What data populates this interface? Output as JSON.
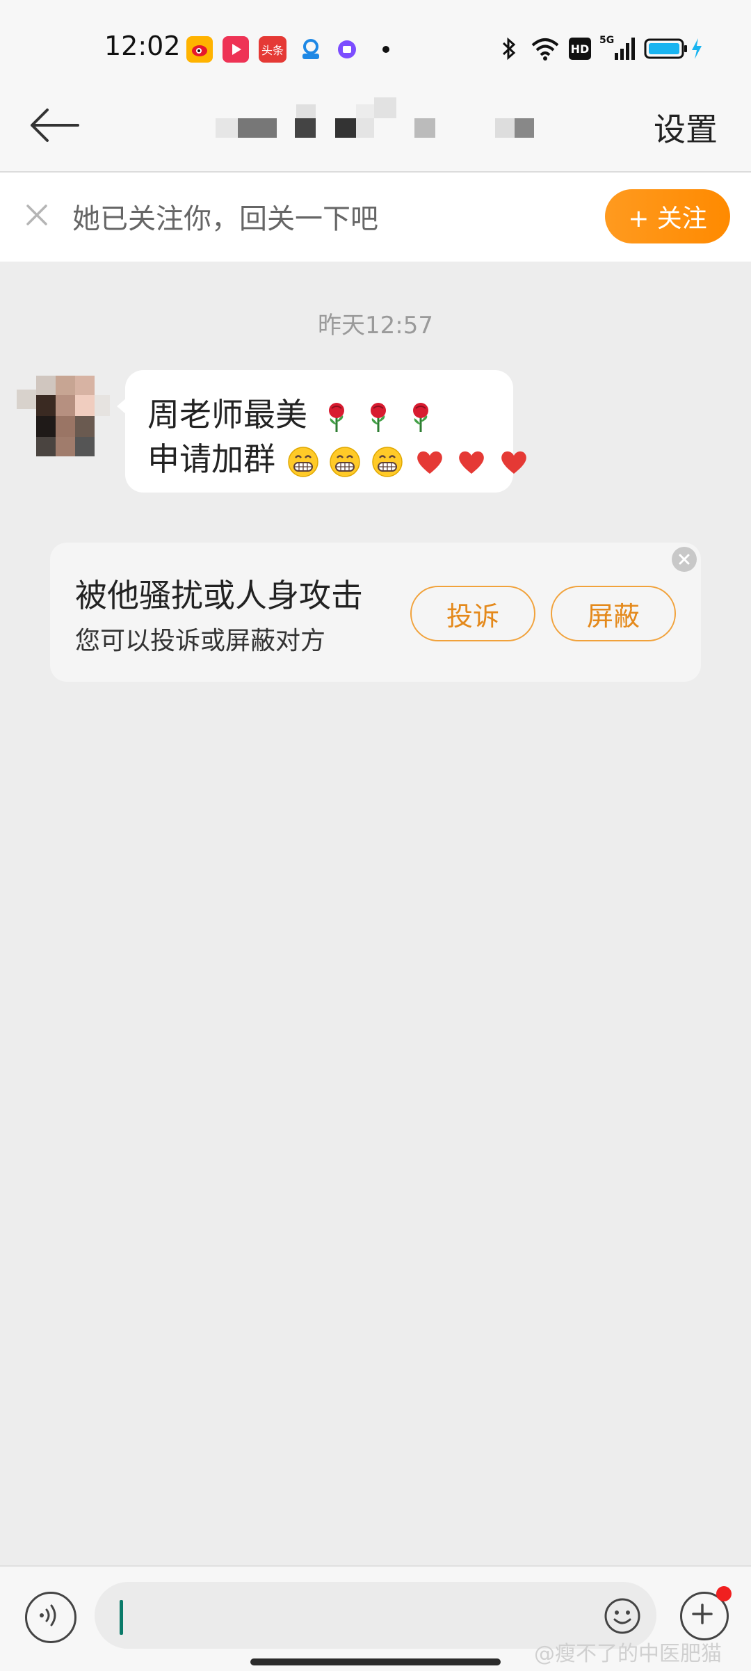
{
  "status_bar": {
    "time": "12:02",
    "left_icons": [
      "weibo-icon",
      "video-play-icon",
      "toutiao-icon",
      "app-icon",
      "purple-app-icon",
      "dot"
    ],
    "left_badge_text": "头条",
    "right_icons": [
      "bluetooth-icon",
      "wifi-icon",
      "hd-icon",
      "signal-5g-icon",
      "battery-icon",
      "charging-icon"
    ],
    "hd_text": "HD",
    "network_text": "5G"
  },
  "nav": {
    "back_icon": "back-arrow-icon",
    "settings_label": "设置"
  },
  "follow_banner": {
    "text": "她已关注你，回关一下吧",
    "button_label": "+ 关注"
  },
  "chat": {
    "time_label": "昨天12:57",
    "message": {
      "line1_text": "周老师最美",
      "line2_text": "申请加群"
    }
  },
  "safety_card": {
    "title": "被他骚扰或人身攻击",
    "subtitle": "您可以投诉或屏蔽对方",
    "report_label": "投诉",
    "block_label": "屏蔽"
  },
  "input_bar": {
    "voice_icon": "voice-icon",
    "emoji_icon": "emoji-icon",
    "plus_icon": "plus-icon"
  },
  "watermark": "@瘦不了的中医肥猫",
  "colors": {
    "accent_orange": "#ff8a00",
    "button_outline": "#f1a23b",
    "caret": "#0a7a69",
    "background": "#ededed"
  }
}
